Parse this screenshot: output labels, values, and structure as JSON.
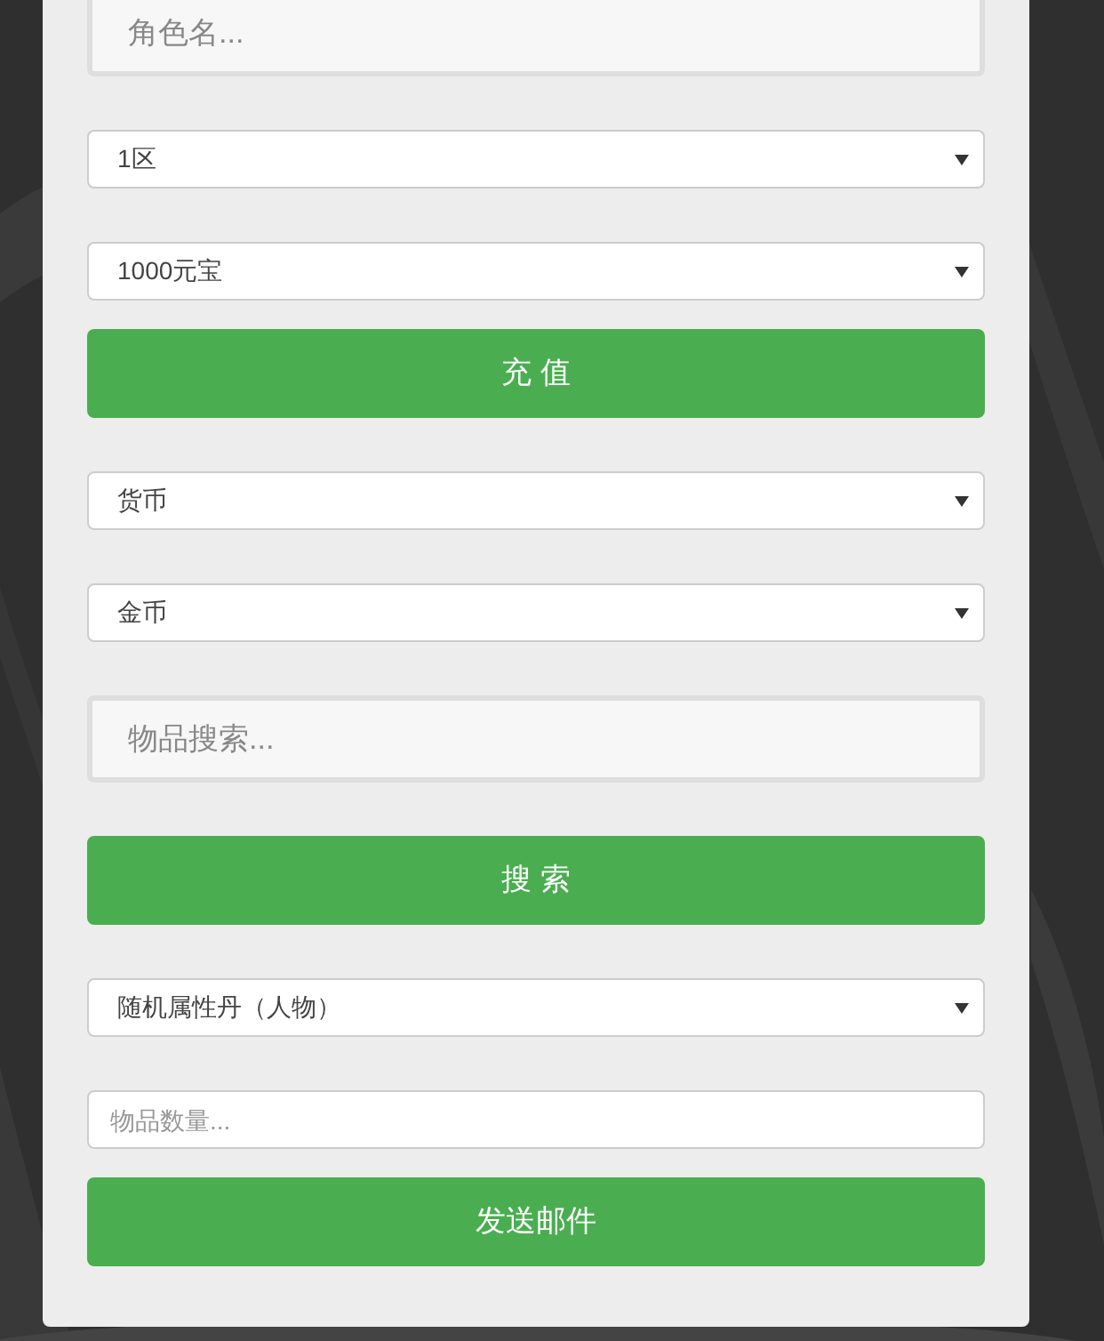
{
  "form": [
    {
      "kind": "field",
      "placeholder": "角色名..."
    },
    {
      "kind": "select",
      "value": "1区"
    },
    {
      "kind": "select",
      "value": "1000元宝"
    },
    {
      "kind": "button",
      "label": "充 值"
    },
    {
      "kind": "select",
      "value": "货币"
    },
    {
      "kind": "select",
      "value": "金币"
    },
    {
      "kind": "field",
      "placeholder": "物品搜索..."
    },
    {
      "kind": "button",
      "label": "搜 索"
    },
    {
      "kind": "select",
      "value": "随机属性丹（人物）"
    },
    {
      "kind": "input",
      "placeholder": "物品数量..."
    },
    {
      "kind": "button",
      "label": "发送邮件"
    }
  ]
}
